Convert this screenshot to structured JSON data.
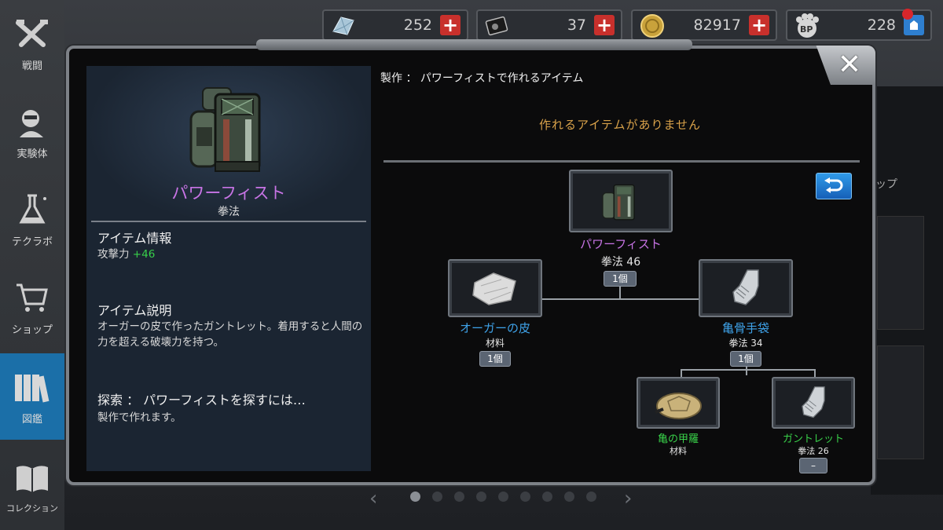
{
  "sidenav": {
    "items": [
      {
        "label": "戦闘",
        "icon": "crossed-guns-icon"
      },
      {
        "label": "実験体",
        "icon": "character-head-icon"
      },
      {
        "label": "テクラボ",
        "icon": "flask-icon"
      },
      {
        "label": "ショップ",
        "icon": "cart-icon"
      },
      {
        "label": "図鑑",
        "icon": "books-icon",
        "active": true
      },
      {
        "label": "コレクション",
        "icon": "open-book-icon"
      }
    ]
  },
  "currencies": [
    {
      "name": "crystal",
      "amount": "252",
      "icon": "crystal-icon"
    },
    {
      "name": "card",
      "amount": "37",
      "icon": "card-icon"
    },
    {
      "name": "gold",
      "amount": "82917",
      "icon": "coin-icon"
    },
    {
      "name": "bp",
      "amount": "228",
      "icon": "bp-paw-icon"
    }
  ],
  "detail": {
    "item_name": "パワーフィスト",
    "item_type": "拳法",
    "info_title": "アイテム情報",
    "stat_label": "攻撃力",
    "stat_value": "+46",
    "desc_title": "アイテム説明",
    "desc_text": "オーガーの皮で作ったガントレット。着用すると人間の力を超える破壊力を持つ。",
    "search_title": "探索 ： パワーフィストを探すには…",
    "search_text": "製作で作れます。"
  },
  "craft": {
    "label": "製作 ： パワーフィストで作れるアイテム",
    "empty_message": "作れるアイテムがありません"
  },
  "tree": {
    "root": {
      "name": "パワーフィスト",
      "sub": "拳法 46",
      "badge": "1個"
    },
    "left": {
      "name": "オーガーの皮",
      "sub": "材料",
      "badge": "1個"
    },
    "right": {
      "name": "亀骨手袋",
      "sub": "拳法 34",
      "badge": "1個"
    },
    "right_left": {
      "name": "亀の甲羅",
      "sub": "材料"
    },
    "right_right": {
      "name": "ガントレット",
      "sub": "拳法 26",
      "badge": "–"
    }
  },
  "background": {
    "side_text": "ップ"
  },
  "colors": {
    "epic": "#c874e6",
    "rare": "#3fa3ea",
    "uncommon": "#39d24a",
    "active_nav": "#1b6fa8",
    "notice": "#d9a24a"
  },
  "pager": {
    "total": 9,
    "active": 1
  }
}
